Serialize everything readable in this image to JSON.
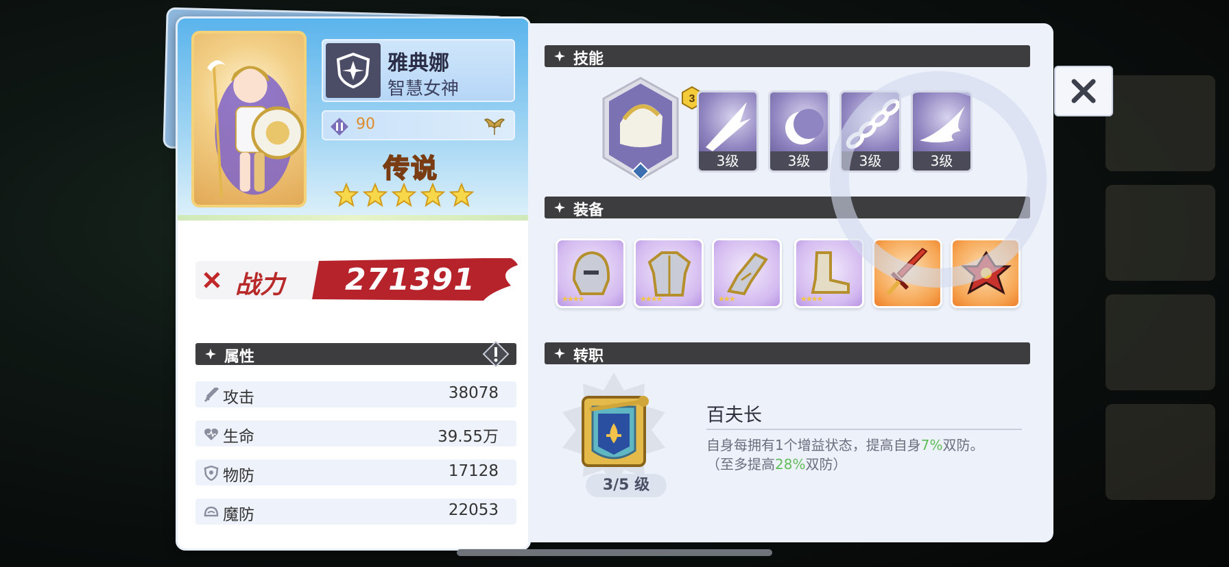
{
  "hero": {
    "name": "雅典娜",
    "title": "智慧女神",
    "level": "90",
    "rarity": "传说",
    "stars": 5,
    "power_label": "战力",
    "power_value": "271391"
  },
  "attributes": {
    "section_title": "属性",
    "stats": [
      {
        "label": "攻击",
        "value": "38078",
        "icon": "sword-icon"
      },
      {
        "label": "生命",
        "value": "39.55万",
        "icon": "heart-icon"
      },
      {
        "label": "物防",
        "value": "17128",
        "icon": "shield-icon"
      },
      {
        "label": "魔防",
        "value": "22053",
        "icon": "magic-shield-icon"
      }
    ]
  },
  "skills": {
    "section_title": "技能",
    "badge": "3",
    "items": [
      {
        "level": "3级",
        "icon": "slash-skill-icon"
      },
      {
        "level": "3级",
        "icon": "moon-skill-icon"
      },
      {
        "level": "3级",
        "icon": "chain-skill-icon"
      },
      {
        "level": "3级",
        "icon": "wing-skill-icon"
      }
    ]
  },
  "equipment": {
    "section_title": "装备",
    "items": [
      {
        "icon": "helmet-icon",
        "rarity": "purple",
        "stars": "★★★★"
      },
      {
        "icon": "armor-icon",
        "rarity": "purple",
        "stars": "★★★★"
      },
      {
        "icon": "gauntlet-icon",
        "rarity": "purple",
        "stars": "★★★"
      },
      {
        "icon": "boots-icon",
        "rarity": "purple",
        "stars": "★★★★"
      },
      {
        "icon": "sword-icon",
        "rarity": "orange",
        "stars": ""
      },
      {
        "icon": "amulet-icon",
        "rarity": "orange",
        "stars": ""
      }
    ]
  },
  "job": {
    "section_title": "转职",
    "name": "百夫长",
    "level": "3/5 级",
    "desc_part1": "自身每拥有1个增益状态，提高自身",
    "desc_hl1": "7%",
    "desc_part2": "双防。",
    "desc_part3": "（至多提高",
    "desc_hl2": "28%",
    "desc_part4": "双防）"
  },
  "colors": {
    "section_bar": "#3d3d3f",
    "highlight_green": "#5fbd5a",
    "power_red": "#b82a2a",
    "level_orange": "#e08a2c"
  }
}
